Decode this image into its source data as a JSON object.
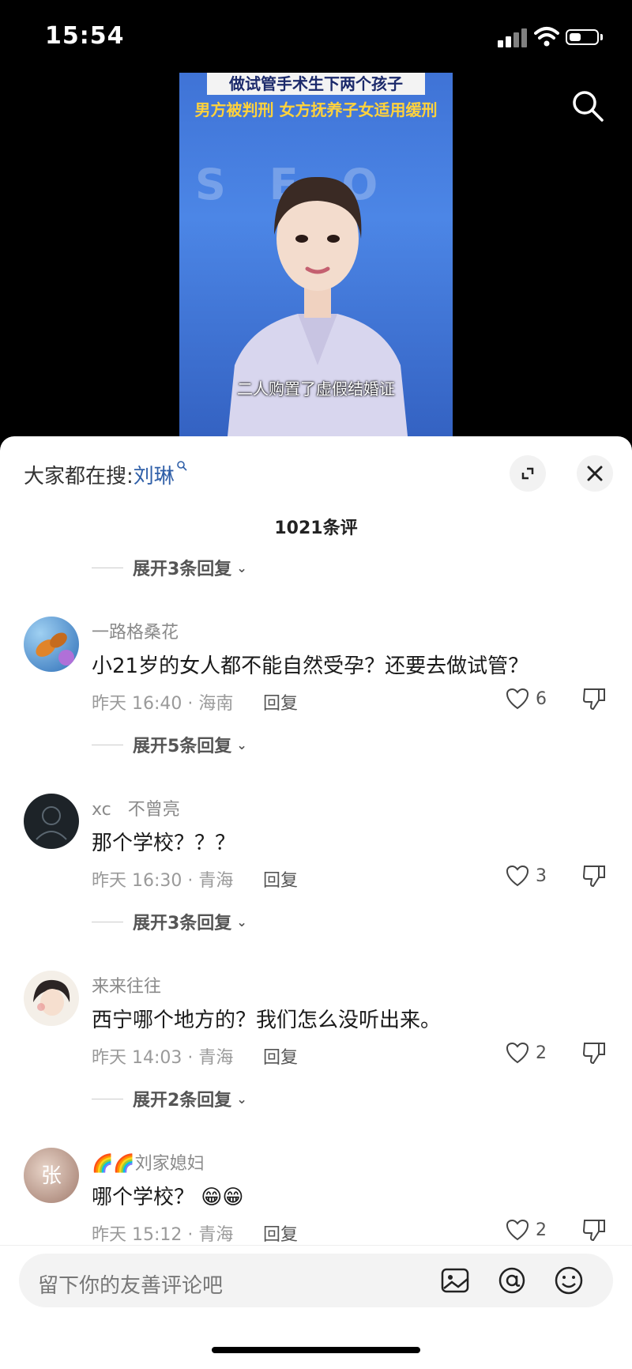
{
  "status_bar": {
    "time": "15:54"
  },
  "video": {
    "headline_top": "做试管手术生下两个孩子",
    "headline_main": "男方被判刑 女方抚养子女适用缓刑",
    "subtitle": "二人购置了虚假结婚证"
  },
  "comments_panel": {
    "search_prefix": "大家都在搜:",
    "search_keyword": "刘琳",
    "count_text": "1021条评",
    "expand_items": [
      {
        "label": "展开3条回复"
      },
      {
        "label": "展开5条回复"
      },
      {
        "label": "展开3条回复"
      },
      {
        "label": "展开2条回复"
      }
    ],
    "comments": [
      {
        "username": "一路格桑花",
        "text": "小21岁的女人都不能自然受孕？还要去做试管？",
        "meta": "昨天 16:40 · 海南",
        "reply": "回复",
        "likes": "6"
      },
      {
        "username": "xc   不曾亮",
        "text": "那个学校？？？",
        "meta": "昨天 16:30 · 青海",
        "reply": "回复",
        "likes": "3"
      },
      {
        "username": "来来往往",
        "text": "西宁哪个地方的？我们怎么没听出来。",
        "meta": "昨天 14:03 · 青海",
        "reply": "回复",
        "likes": "2"
      },
      {
        "username": "🌈🌈刘家媳妇",
        "text": "哪个学校？ 😁😁",
        "meta": "昨天 15:12 · 青海",
        "reply": "回复",
        "likes": "2",
        "avatar_char": "张"
      }
    ]
  },
  "input": {
    "placeholder": "留下你的友善评论吧"
  },
  "icons": [
    "search-icon",
    "expand-icon",
    "close-icon",
    "heart-icon",
    "dislike-icon",
    "image-icon",
    "at-icon",
    "emoji-icon"
  ]
}
